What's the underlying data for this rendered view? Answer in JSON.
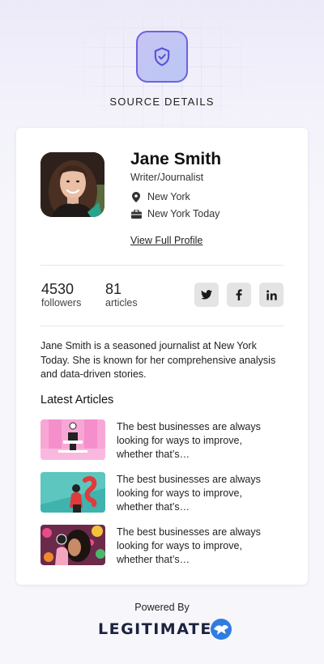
{
  "header": {
    "title": "SOURCE DETAILS",
    "icon": "shield-check-icon"
  },
  "profile": {
    "name": "Jane Smith",
    "role": "Writer/Journalist",
    "location": "New York",
    "organization": "New York Today",
    "view_profile_label": "View Full Profile"
  },
  "stats": {
    "followers_value": "4530",
    "followers_label": "followers",
    "articles_value": "81",
    "articles_label": "articles"
  },
  "social": [
    "twitter-icon",
    "facebook-icon",
    "linkedin-icon"
  ],
  "bio": "Jane Smith is a seasoned journalist at New York Today. She is known for her comprehensive analysis and data-driven stories.",
  "latest": {
    "title": "Latest Articles",
    "articles": [
      {
        "text": "The best businesses are always looking for ways to improve, whether that’s…"
      },
      {
        "text": "The best businesses are always looking for ways to improve, whether that’s…"
      },
      {
        "text": "The best businesses are always looking for ways to improve, whether that’s…"
      }
    ]
  },
  "footer": {
    "powered_by": "Powered By",
    "brand": "LEGITIMATE"
  },
  "colors": {
    "accent": "#6b63e0",
    "logo_blue": "#2f7de0"
  }
}
